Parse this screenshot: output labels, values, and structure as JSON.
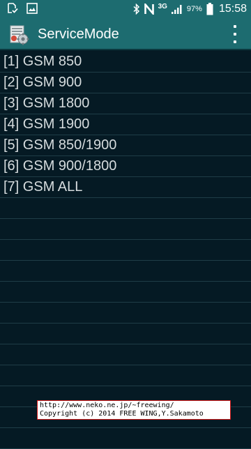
{
  "status_bar": {
    "network_type": "3G",
    "battery_percent": "97%",
    "time": "15:58",
    "icons": [
      "notification-sim-icon",
      "notification-image-icon",
      "bluetooth-icon",
      "nfc-icon",
      "signal-icon",
      "battery-icon"
    ]
  },
  "action_bar": {
    "title": "ServiceMode",
    "app_icon": "service-mode-app-icon",
    "menu_icon": "overflow-menu-icon"
  },
  "menu_items": [
    "[1] GSM 850",
    "[2] GSM 900",
    "[3] GSM 1800",
    "[4] GSM 1900",
    "[5] GSM 850/1900",
    "[6] GSM 900/1800",
    "[7] GSM ALL"
  ],
  "watermark": {
    "line1": "http://www.neko.ne.jp/~freewing/",
    "line2": "Copyright (c) 2014 FREE WING,Y.Sakamoto"
  },
  "colors": {
    "action_bar": "#1d6c70",
    "background": "#051a24",
    "divider": "#1f3d47",
    "text": "#d6dcde",
    "watermark_border": "#d01818"
  }
}
